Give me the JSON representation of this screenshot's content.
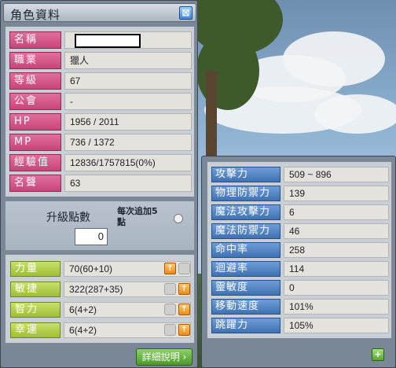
{
  "window": {
    "title": "角色資料",
    "close_glyph": "⊠"
  },
  "info": [
    {
      "label": "名稱",
      "value": ""
    },
    {
      "label": "職業",
      "value": "獵人"
    },
    {
      "label": "等級",
      "value": "67"
    },
    {
      "label": "公會",
      "value": "-"
    },
    {
      "label": "HP",
      "value": "1956 / 2011"
    },
    {
      "label": "MP",
      "value": "736 / 1372"
    },
    {
      "label": "經驗值",
      "value": "12836/1757815(0%)"
    },
    {
      "label": "名聲",
      "value": "63"
    }
  ],
  "ap": {
    "label": "升級點數",
    "value": "0",
    "auto_label": "每次追加5點"
  },
  "stats": [
    {
      "label": "力量",
      "value": "70(60+10)"
    },
    {
      "label": "敏捷",
      "value": "322(287+35)"
    },
    {
      "label": "智力",
      "value": "6(4+2)"
    },
    {
      "label": "幸運",
      "value": "6(4+2)"
    }
  ],
  "detail_button": "詳細說明 ›",
  "detail": [
    {
      "label": "攻擊力",
      "value": "509 ~ 896"
    },
    {
      "label": "物理防禦力",
      "value": "139"
    },
    {
      "label": "魔法攻擊力",
      "value": "6"
    },
    {
      "label": "魔法防禦力",
      "value": "46"
    },
    {
      "label": "命中率",
      "value": "258"
    },
    {
      "label": "迴避率",
      "value": "114"
    },
    {
      "label": "靈敏度",
      "value": "0"
    },
    {
      "label": "移動速度",
      "value": "101%"
    },
    {
      "label": "跳躍力",
      "value": "105%"
    }
  ],
  "detail_small_button": "+",
  "up_glyph": "↑",
  "colors": {
    "info_label": "#c8457a",
    "stat_label": "#9fbd36",
    "detail_label": "#3f72b4",
    "window_frame": "#7a8796"
  }
}
